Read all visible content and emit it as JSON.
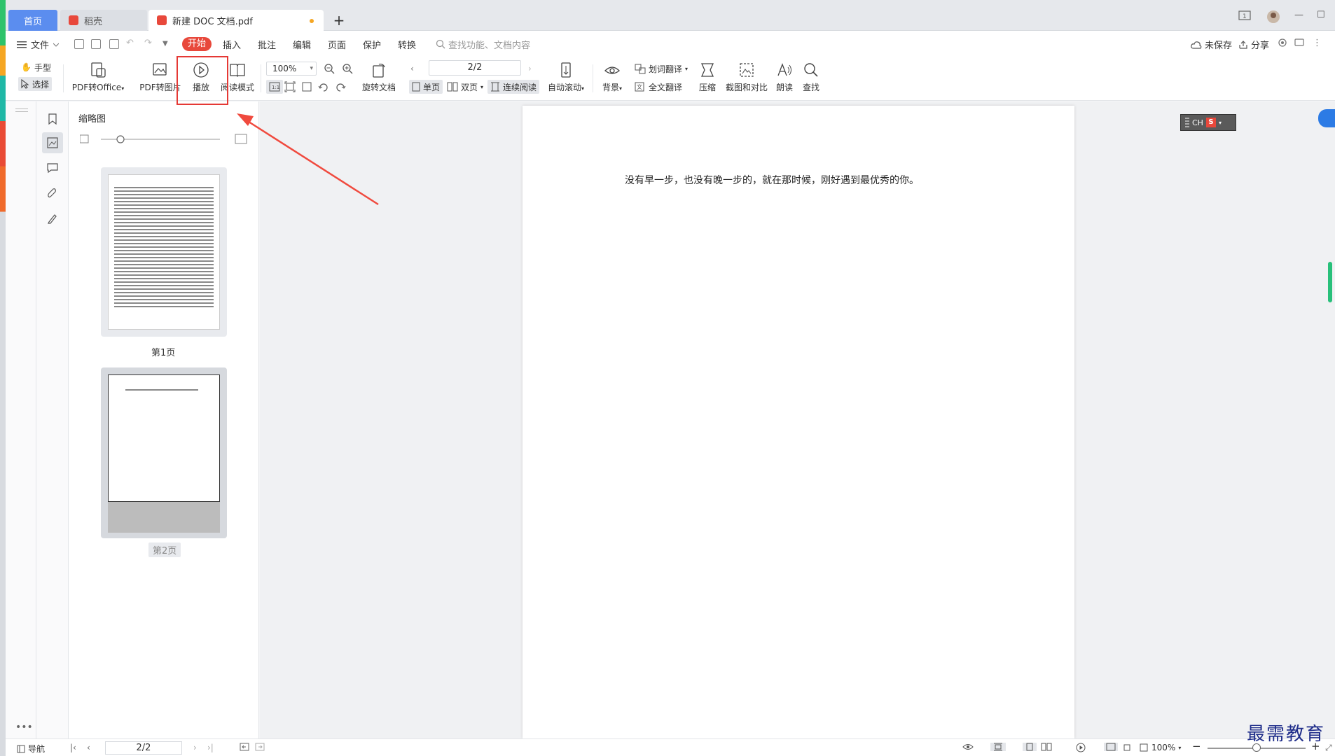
{
  "tabs": {
    "home": "首页",
    "daoke": "稻壳",
    "doc": "新建 DOC 文档.pdf",
    "add": "+"
  },
  "window": {
    "minimize": "—",
    "maximize": "☐"
  },
  "menu": {
    "file": "文件",
    "start": "开始",
    "insert": "插入",
    "annotate": "批注",
    "edit": "编辑",
    "page": "页面",
    "protect": "保护",
    "convert": "转换",
    "search_placeholder": "查找功能、文档内容",
    "unsaved": "未保存",
    "share": "分享"
  },
  "ribbon": {
    "hand": "手型",
    "select": "选择",
    "pdf_to_office": "PDF转Office",
    "pdf_to_image": "PDF转图片",
    "play": "播放",
    "read_mode": "阅读模式",
    "zoom": "100%",
    "rotate_doc": "旋转文档",
    "page_indicator": "2/2",
    "single_page": "单页",
    "double_page": "双页",
    "continuous": "连续阅读",
    "auto_scroll": "自动滚动",
    "background": "背景",
    "word_translate": "划词翻译",
    "full_translate": "全文翻译",
    "compress": "压缩",
    "screenshot_compare": "截图和对比",
    "read_aloud": "朗读",
    "find": "查找"
  },
  "thumbs": {
    "title": "缩略图",
    "page1_label": "第1页",
    "page2_label": "第2页"
  },
  "document": {
    "text": "没有早一步，也没有晚一步的，就在那时候，刚好遇到最优秀的你。"
  },
  "ime": {
    "label": "CH"
  },
  "statusbar": {
    "nav": "导航",
    "page": "2/2",
    "zoom": "100%"
  },
  "watermark": "最需教育",
  "colors": {
    "accent": "#e8483b",
    "home_tab": "#5b8def",
    "highlight": "#e53935"
  }
}
